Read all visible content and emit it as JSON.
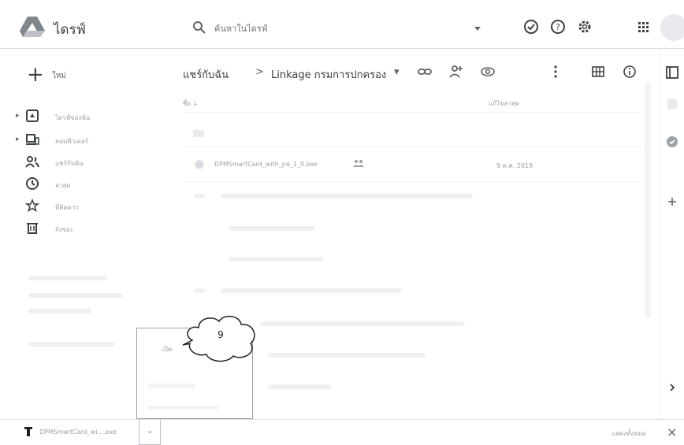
{
  "app": {
    "title": "ไดรฟ์"
  },
  "search": {
    "placeholder": "ค้นหาในไดรฟ์"
  },
  "sidebar": {
    "new_label": "ใหม่",
    "items": [
      {
        "label": "ไดรฟ์ของฉัน",
        "icon": "my-drive-icon",
        "caret": "▸"
      },
      {
        "label": "คอมพิวเตอร์",
        "icon": "computer-icon",
        "caret": "▸"
      },
      {
        "label": "แชร์กับฉัน",
        "icon": "shared-people-icon"
      },
      {
        "label": "ล่าสุด",
        "icon": "clock-icon"
      },
      {
        "label": "ที่ติดดาว",
        "icon": "star-icon"
      },
      {
        "label": "ถังขยะ",
        "icon": "trash-icon"
      }
    ]
  },
  "breadcrumb": {
    "root": "แชร์กับฉัน",
    "separator": ">",
    "current": "Linkage กรมการปกครอง",
    "dropdown": "▾"
  },
  "list": {
    "col_name": "ชื่อ ↓",
    "col_date": "แก้ไขล่าสุด",
    "file": {
      "name": "DPMSmartCard_with_jre_1_0.exe",
      "date": "9 ต.ค. 2019"
    }
  },
  "popup": {
    "label": "เปิด"
  },
  "callout": {
    "number": "9"
  },
  "download_bar": {
    "file_name": "DPMSmartCard_wi....exe",
    "show_all": "แสดงทั้งหมด",
    "close": "×",
    "toggle": "⌄"
  },
  "colors": {
    "accent": "#1a73e8",
    "icon": "#5f6368",
    "muted": "#9aa0a6"
  }
}
